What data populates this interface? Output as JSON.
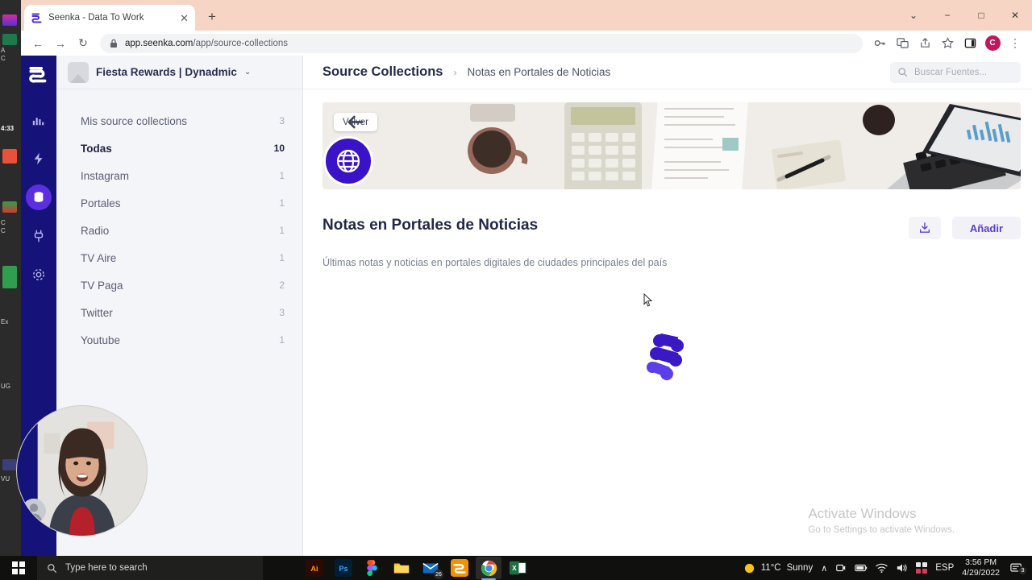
{
  "browser": {
    "tab": {
      "title": "Seenka - Data To Work",
      "close_label": "✕",
      "favicon": "seenka-logo-icon"
    },
    "new_tab_label": "+",
    "window_controls": {
      "minimize_group": "⌄",
      "minimize": "−",
      "maximize": "□",
      "close": "✕"
    },
    "nav": {
      "back": "←",
      "forward": "→",
      "reload": "↻"
    },
    "omnibox": {
      "lock_icon": "lock-icon",
      "url_host": "app.seenka.com",
      "url_path": "/app/source-collections"
    },
    "toolbar_icons": [
      "key-icon",
      "translate-icon",
      "share-icon",
      "bookmark-star-icon",
      "side-panel-icon"
    ],
    "profile_initial": "C",
    "menu_label": "⋮"
  },
  "rail": {
    "logo": "seenka-logo-icon",
    "items": [
      {
        "name": "analytics-icon",
        "active": false
      },
      {
        "name": "pulse-icon",
        "active": false
      },
      {
        "name": "database-icon",
        "active": true
      },
      {
        "name": "plug-icon",
        "active": false
      },
      {
        "name": "settings-gear-icon",
        "active": false
      }
    ]
  },
  "sidebar": {
    "workspace": {
      "name": "Fiesta Rewards | Dynadmic",
      "caret": "⌄"
    },
    "items": [
      {
        "label": "Mis source collections",
        "count": "3",
        "active": false
      },
      {
        "label": "Todas",
        "count": "10",
        "active": true
      },
      {
        "label": "Instagram",
        "count": "1",
        "active": false
      },
      {
        "label": "Portales",
        "count": "1",
        "active": false
      },
      {
        "label": "Radio",
        "count": "1",
        "active": false
      },
      {
        "label": "TV Aire",
        "count": "1",
        "active": false
      },
      {
        "label": "TV Paga",
        "count": "2",
        "active": false
      },
      {
        "label": "Twitter",
        "count": "3",
        "active": false
      },
      {
        "label": "Youtube",
        "count": "1",
        "active": false
      }
    ]
  },
  "main": {
    "breadcrumb": {
      "root": "Source Collections",
      "separator": "›",
      "leaf": "Notas en Portales de Noticias"
    },
    "search": {
      "placeholder": "Buscar Fuentes...",
      "icon": "search-icon"
    },
    "back_button": {
      "label": "Volver",
      "icon": "arrow-left-icon"
    },
    "collection_avatar_icon": "globe-icon",
    "title": "Notas en Portales de Noticias",
    "description": "Últimas notas y noticias en portales digitales de ciudades principales del país",
    "download_button_icon": "download-icon",
    "add_button_label": "Añadir",
    "loading_icon": "seenka-loading-logo"
  },
  "watermark": {
    "line1": "Activate Windows",
    "line2": "Go to Settings to activate Windows."
  },
  "background_app": {
    "timestamp": "4:33",
    "fragments": [
      "A",
      "C",
      "C",
      "C",
      "Ex",
      "UG",
      "VU"
    ]
  },
  "taskbar": {
    "start_icon": "windows-start-icon",
    "search_placeholder": "Type here to search",
    "search_icon": "search-icon",
    "apps": [
      {
        "name": "adobe-illustrator-icon",
        "label": "Ai",
        "running": false
      },
      {
        "name": "adobe-photoshop-icon",
        "label": "Ps",
        "running": false
      },
      {
        "name": "figma-icon",
        "label": "",
        "running": false
      },
      {
        "name": "file-explorer-icon",
        "label": "",
        "running": false
      },
      {
        "name": "mail-icon",
        "label": "26",
        "running": false
      },
      {
        "name": "seenka-icon",
        "label": "",
        "running": false
      },
      {
        "name": "chrome-icon",
        "label": "",
        "running": true
      },
      {
        "name": "excel-icon",
        "label": "X",
        "running": false
      }
    ],
    "tray": {
      "weather_icon": "sun-icon",
      "temperature": "11°C",
      "condition": "Sunny",
      "chevron": "∧",
      "icons": [
        "meet-camera-icon",
        "battery-icon",
        "wifi-icon",
        "volume-icon",
        "onedrive-icon"
      ],
      "language": "ESP",
      "time": "3:56 PM",
      "date": "4/29/2022",
      "notification_icon": "notification-icon",
      "notification_count": "3"
    }
  },
  "colors": {
    "rail_bg": "#15137a",
    "accent_purple": "#5b3fd1",
    "avatar_purple": "#3a13c9",
    "titlebar": "#f6d5c4",
    "sidebar_bg": "#f4f5f8"
  }
}
